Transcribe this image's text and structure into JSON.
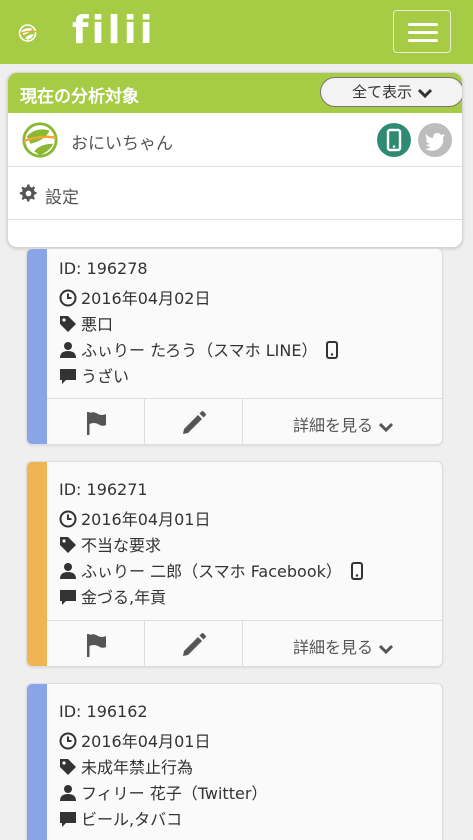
{
  "header": {
    "logo_text": "filii",
    "menu_icon": "hamburger-icon"
  },
  "panel": {
    "title": "現在の分析対象",
    "show_all_label": "全て表示",
    "target_name": "おにいちゃん",
    "settings_label": "設定"
  },
  "cards": [
    {
      "id": "ID: 196278",
      "date": "2016年04月02日",
      "category": "悪口",
      "user": "ふぃりー たろう（スマホ LINE）",
      "keywords": "うざい",
      "detail_label": "詳細を見る",
      "accent": "#8aa4e8"
    },
    {
      "id": "ID: 196271",
      "date": "2016年04月01日",
      "category": "不当な要求",
      "user": "ふぃりー 二郎（スマホ Facebook）",
      "keywords": "金づる,年貢",
      "detail_label": "詳細を見る",
      "accent": "#f0b455"
    },
    {
      "id": "ID: 196162",
      "date": "2016年04月01日",
      "category": "未成年禁止行為",
      "user": "フィリー 花子（Twitter）",
      "keywords": "ビール,タバコ",
      "accent": "#8aa4e8"
    }
  ],
  "colors": {
    "brand_green": "#a6cb44",
    "phone_active": "#2e8b72",
    "twitter_inactive": "#bdbdbd"
  }
}
